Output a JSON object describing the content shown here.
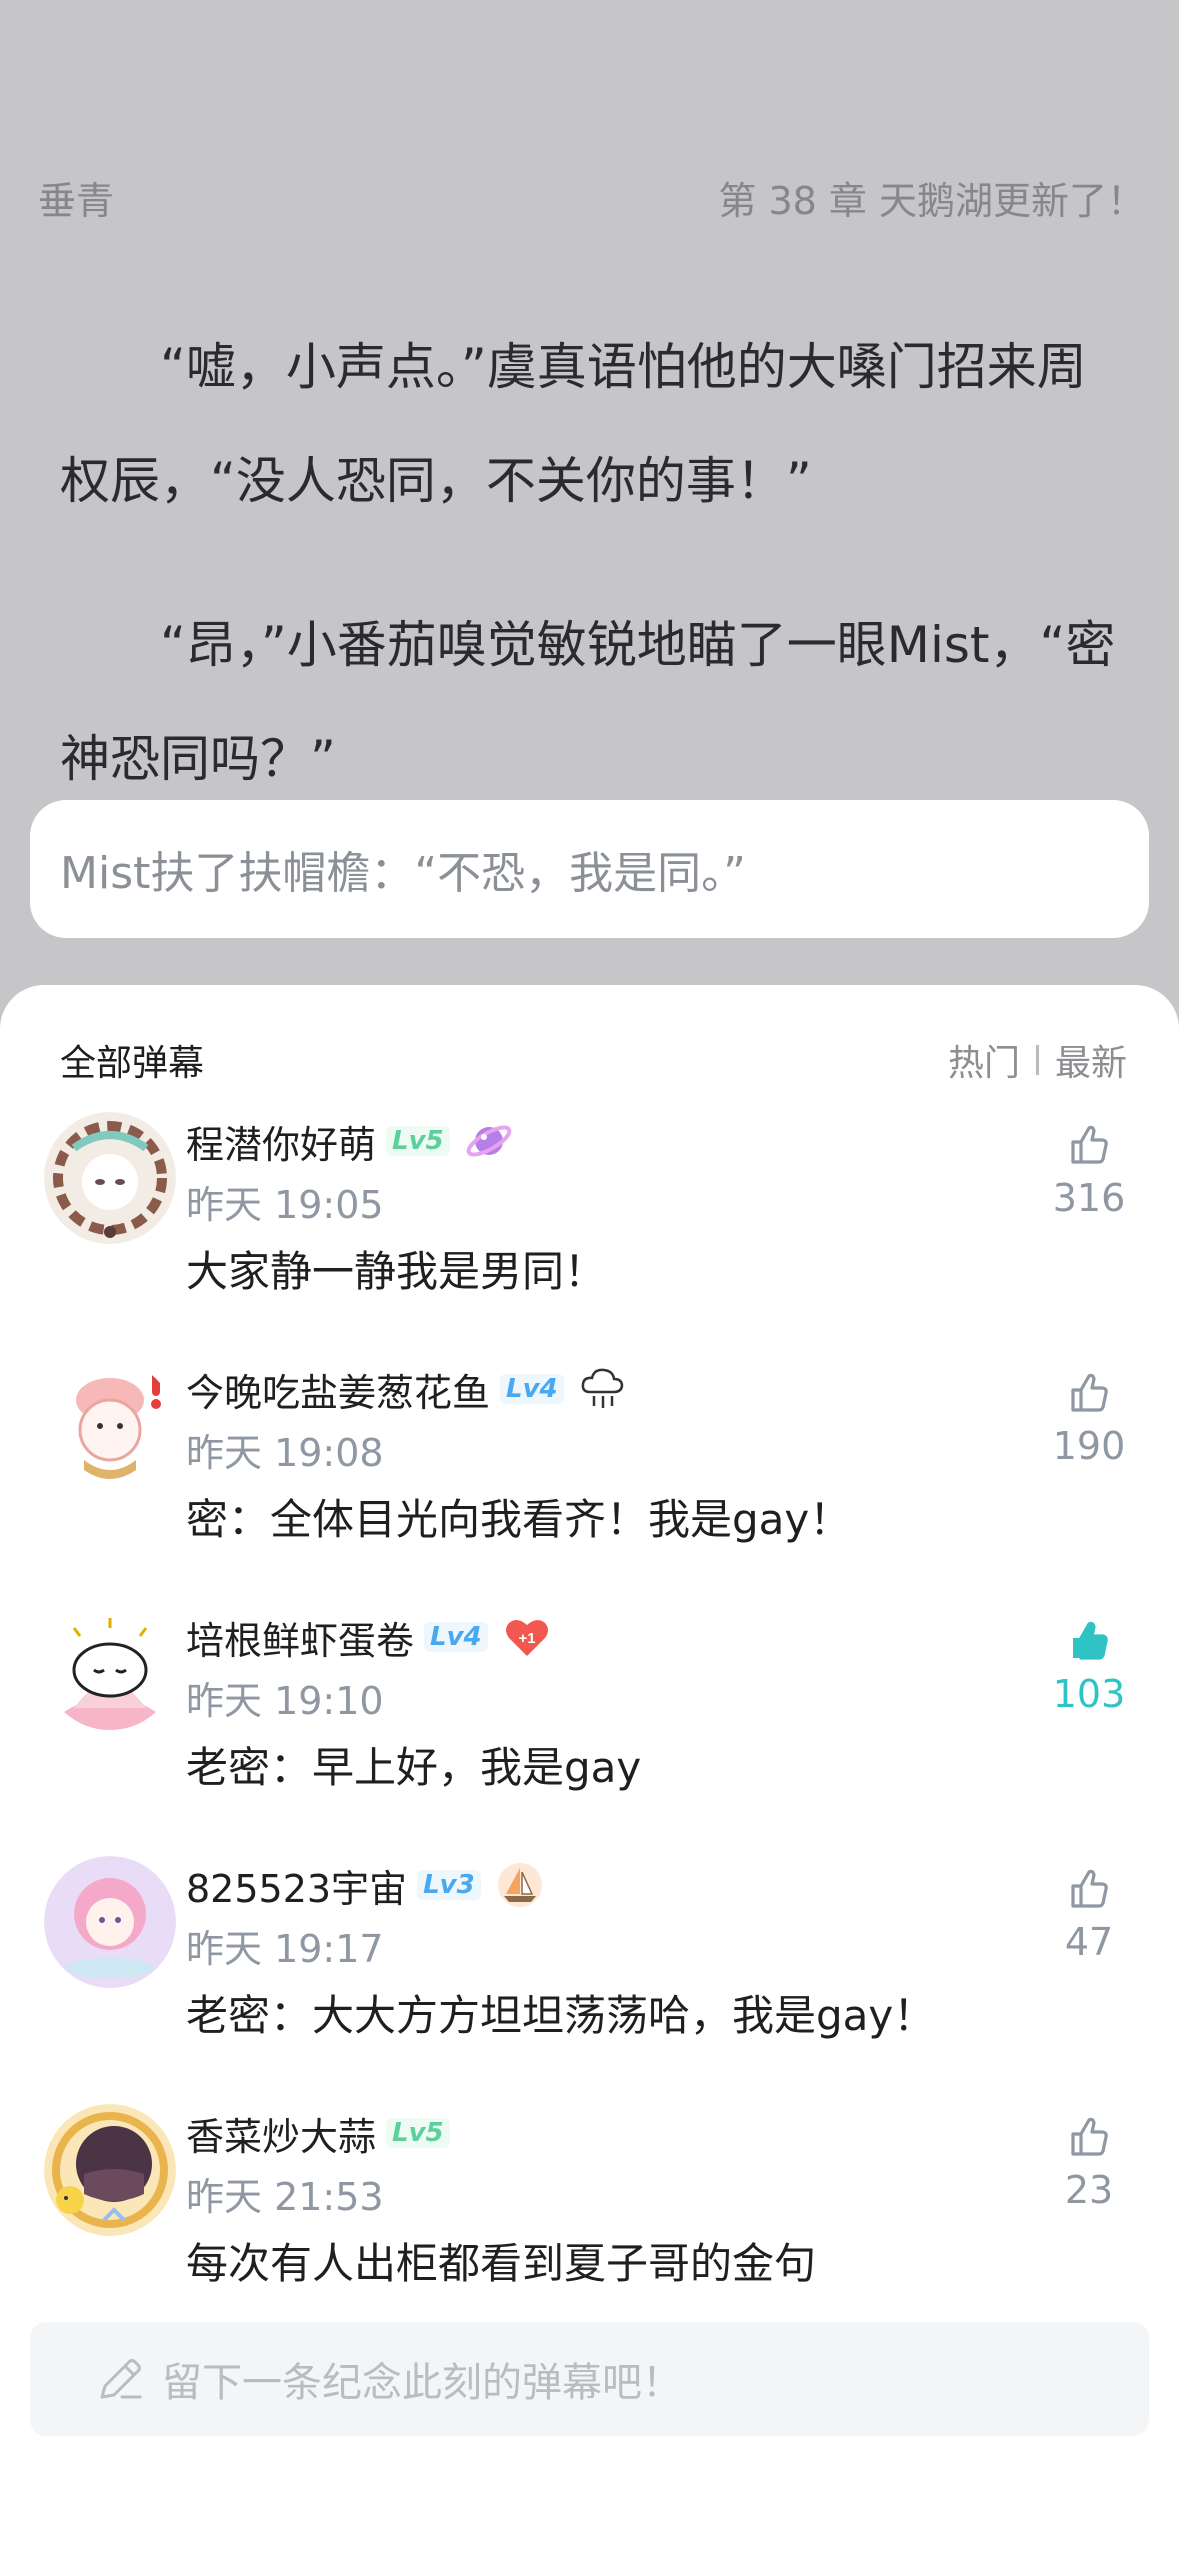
{
  "header": {
    "book_title": "垂青",
    "chapter_title": "第 38 章 天鹅湖更新了！"
  },
  "story": {
    "paragraphs": [
      "“嘘，小声点。”虞真语怕他的大嗓门招来周权辰，“没人恐同，不关你的事！”",
      "“昂，”小番茄嗅觉敏锐地瞄了一眼Mist，“密神恐同吗？”"
    ],
    "highlighted_quote": "Mist扶了扶帽檐：“不恐，我是同。”"
  },
  "danmaku": {
    "title": "全部弹幕",
    "sort_hot": "热门",
    "sort_new": "最新",
    "comments": [
      {
        "name": "程潜你好萌",
        "level": "Lv5",
        "medal": "planet-medal-icon",
        "time": "昨天 19:05",
        "text": "大家静一静我是男同！",
        "likes": "316",
        "liked": false
      },
      {
        "name": "今晚吃盐姜葱花鱼",
        "level": "Lv4",
        "medal": "cloud-medal-icon",
        "time": "昨天 19:08",
        "text": "密：全体目光向我看齐！我是gay！",
        "likes": "190",
        "liked": false
      },
      {
        "name": "培根鲜虾蛋卷",
        "level": "Lv4",
        "medal": "heart-plus-one-medal-icon",
        "time": "昨天 19:10",
        "text": "老密：早上好，我是gay",
        "likes": "103",
        "liked": true
      },
      {
        "name": "825523宇宙",
        "level": "Lv3",
        "medal": "sailboat-medal-icon",
        "time": "昨天 19:17",
        "text": "老密：大大方方坦坦荡荡哈，我是gay！",
        "likes": "47",
        "liked": false
      },
      {
        "name": "香菜炒大蒜",
        "level": "Lv5",
        "medal": "",
        "time": "昨天 21:53",
        "text": "每次有人出柜都看到夏子哥的金句",
        "likes": "23",
        "liked": false
      }
    ],
    "medal_plus_one": "+1",
    "input_placeholder": "留下一条纪念此刻的弹幕吧！"
  },
  "colors": {
    "reader_background": "#c6c6c9",
    "accent_liked": "#2fc3c6",
    "meta_text": "#8e97a2"
  }
}
